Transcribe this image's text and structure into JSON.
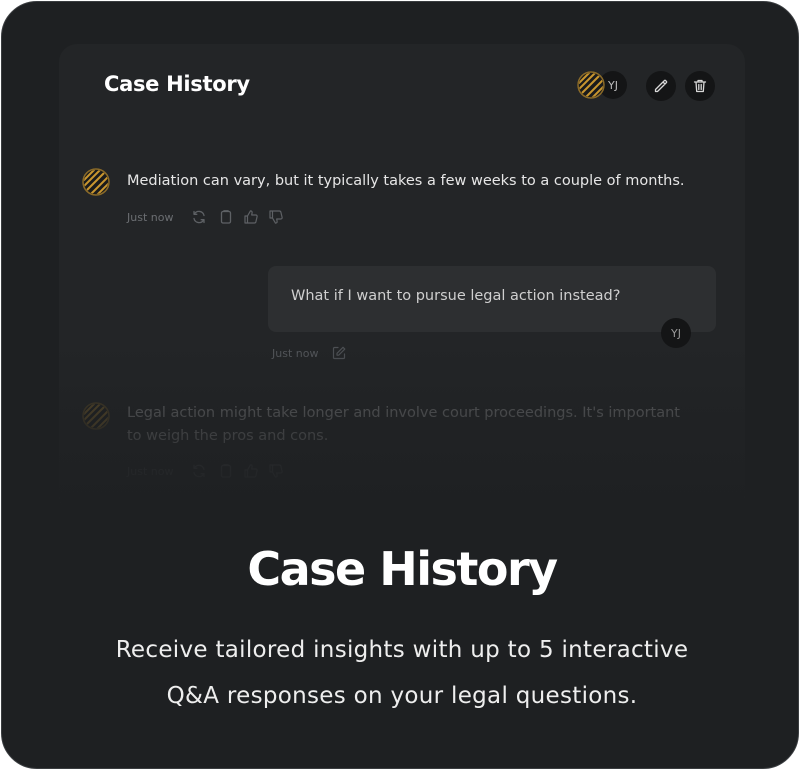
{
  "card": {
    "title": "Case History",
    "header_avatar_initials": "YJ"
  },
  "messages": [
    {
      "role": "assistant",
      "text": "Mediation can vary, but it typically takes a few weeks to a couple of months.",
      "time": "Just now"
    },
    {
      "role": "user",
      "text": "What if I want to pursue legal action instead?",
      "time": "Just now",
      "initials": "YJ"
    },
    {
      "role": "assistant",
      "text_line1": "Legal action might take longer and involve court proceedings. It's important",
      "text_line2": "to weigh the pros and cons.",
      "time": "Just now"
    }
  ],
  "hero": {
    "title": "Case History",
    "subtitle_line1": "Receive tailored insights with up to 5 interactive",
    "subtitle_line2": "Q&A responses on your legal questions."
  },
  "icons": [
    "logo-icon",
    "edit-icon",
    "trash-icon",
    "regenerate-icon",
    "copy-icon",
    "thumbs-up-icon",
    "thumbs-down-icon"
  ],
  "colors": {
    "background": "#1e2022",
    "card": "#232527",
    "accent": "#c9962f"
  }
}
